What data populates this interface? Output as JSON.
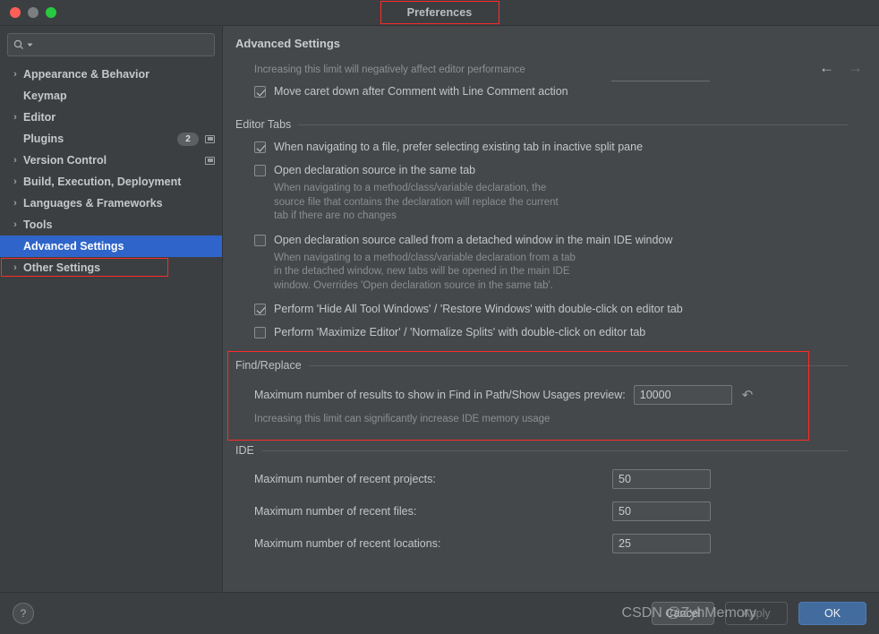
{
  "window": {
    "title": "Preferences",
    "traffic_lights": [
      "close-button",
      "minimize-button",
      "maximize-button"
    ]
  },
  "sidebar": {
    "search": {
      "value": "",
      "placeholder": "",
      "icon": "search-icon",
      "caret": "chevron-down-icon"
    },
    "items": [
      {
        "label": "Appearance & Behavior",
        "arrow": true,
        "selected": false,
        "badge": null,
        "tool_icon": false
      },
      {
        "label": "Keymap",
        "arrow": false,
        "selected": false,
        "badge": null,
        "tool_icon": false
      },
      {
        "label": "Editor",
        "arrow": true,
        "selected": false,
        "badge": null,
        "tool_icon": false
      },
      {
        "label": "Plugins",
        "arrow": false,
        "selected": false,
        "badge": "2",
        "tool_icon": true
      },
      {
        "label": "Version Control",
        "arrow": true,
        "selected": false,
        "badge": null,
        "tool_icon": true
      },
      {
        "label": "Build, Execution, Deployment",
        "arrow": true,
        "selected": false,
        "badge": null,
        "tool_icon": false
      },
      {
        "label": "Languages & Frameworks",
        "arrow": true,
        "selected": false,
        "badge": null,
        "tool_icon": false
      },
      {
        "label": "Tools",
        "arrow": true,
        "selected": false,
        "badge": null,
        "tool_icon": false
      },
      {
        "label": "Advanced Settings",
        "arrow": false,
        "selected": true,
        "badge": null,
        "tool_icon": false
      },
      {
        "label": "Other Settings",
        "arrow": true,
        "selected": false,
        "badge": null,
        "tool_icon": false
      }
    ]
  },
  "content": {
    "page_title": "Advanced Settings",
    "nav": {
      "back": "←",
      "forward": "→"
    },
    "top_hint": "Increasing this limit will negatively affect editor performance",
    "top_checkbox": {
      "label": "Move caret down after Comment with Line Comment action",
      "checked": true
    },
    "editor_tabs": {
      "section_title": "Editor Tabs",
      "options": [
        {
          "label": "When navigating to a file, prefer selecting existing tab in inactive split pane",
          "checked": true,
          "description": ""
        },
        {
          "label": "Open declaration source in the same tab",
          "checked": false,
          "description": "When navigating to a method/class/variable declaration, the\nsource file that contains the declaration will replace the current\ntab if there are no changes"
        },
        {
          "label": "Open declaration source called from a detached window in the main IDE window",
          "checked": false,
          "description": "When navigating to a method/class/variable declaration from a tab\nin the detached window, new tabs will be opened in the main IDE\nwindow. Overrides 'Open declaration source in the same tab'."
        },
        {
          "label": "Perform 'Hide All Tool Windows' / 'Restore Windows' with double-click on editor tab",
          "checked": true,
          "description": ""
        },
        {
          "label": "Perform 'Maximize Editor' / 'Normalize Splits' with double-click on editor tab",
          "checked": false,
          "description": ""
        }
      ]
    },
    "find_replace": {
      "section_title": "Find/Replace",
      "field_label": "Maximum number of results to show in Find in Path/Show Usages preview:",
      "field_value": "10000",
      "revert_icon": "revert-arrow-icon",
      "hint": "Increasing this limit can significantly increase IDE memory usage",
      "highlighted": true
    },
    "ide": {
      "section_title": "IDE",
      "rows": [
        {
          "label": "Maximum number of recent projects:",
          "value": "50"
        },
        {
          "label": "Maximum number of recent files:",
          "value": "50"
        },
        {
          "label": "Maximum number of recent locations:",
          "value": "25"
        }
      ]
    }
  },
  "footer": {
    "help": "?",
    "cancel": "Cancel",
    "apply": "Apply",
    "ok": "OK",
    "watermark": "CSDN @ZyhMemory"
  },
  "colors": {
    "window_bg": "#45484a",
    "chrome_bg": "#3c3f41",
    "selection_blue": "#2f65ca",
    "primary_button": "#436c9e",
    "annotation_red": "#ff2a2a",
    "text": "#c3c6c8",
    "muted_text": "#8a8d90"
  }
}
